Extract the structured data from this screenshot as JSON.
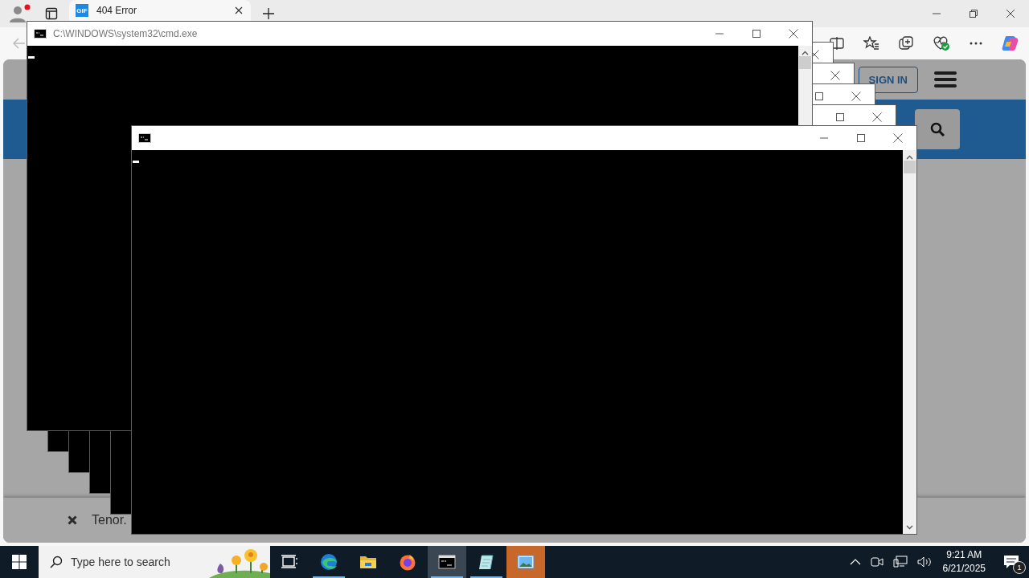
{
  "browser": {
    "profile": {
      "notification": true
    },
    "tabs": [
      {
        "favicon_label": "GIF",
        "title": "404 Error",
        "selected": true
      }
    ],
    "page": {
      "sign_in": "SIGN IN",
      "footer_banner": {
        "text": "Tenor."
      }
    }
  },
  "console_windows": [
    {
      "kind": "console",
      "title": "C:\\WINDOWS\\system32\\cmd.exe"
    },
    {
      "kind": "console"
    },
    {
      "kind": "console"
    },
    {
      "kind": "console"
    },
    {
      "kind": "console"
    },
    {
      "kind": "console"
    }
  ],
  "taskbar": {
    "search_placeholder": "Type here to search",
    "apps": [
      {
        "kind": "task-view",
        "running": false,
        "active": false,
        "flashing": false
      },
      {
        "kind": "edge",
        "running": true,
        "active": false,
        "flashing": false
      },
      {
        "kind": "explorer",
        "running": false,
        "active": false,
        "flashing": false
      },
      {
        "kind": "firefox",
        "running": false,
        "active": false,
        "flashing": false
      },
      {
        "kind": "console",
        "running": true,
        "active": true,
        "flashing": false
      },
      {
        "kind": "notepad",
        "running": true,
        "active": false,
        "flashing": false
      },
      {
        "kind": "photos",
        "running": false,
        "active": false,
        "flashing": true
      }
    ],
    "tray": {
      "time": "9:21 AM",
      "date": "6/21/2025",
      "notification_count": "1"
    }
  }
}
